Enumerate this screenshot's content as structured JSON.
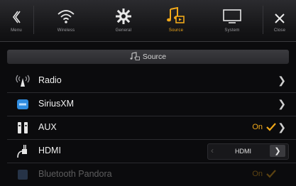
{
  "tabs": [
    {
      "label": "Menu"
    },
    {
      "label": "Wireless"
    },
    {
      "label": "General"
    },
    {
      "label": "Source"
    },
    {
      "label": "System"
    },
    {
      "label": "Close"
    }
  ],
  "active_tab": "Source",
  "section": {
    "title": "Source"
  },
  "rows": [
    {
      "label": "Radio",
      "icon": "antenna-icon"
    },
    {
      "label": "SiriusXM",
      "icon": "siriusxm-icon"
    },
    {
      "label": "AUX",
      "icon": "rca-plug-icon",
      "status": "On"
    },
    {
      "label": "HDMI",
      "icon": "hdmi-cable-icon",
      "value": "HDMI"
    },
    {
      "label": "Bluetooth Pandora",
      "icon": "pandora-icon",
      "status": "On"
    }
  ],
  "colors": {
    "accent": "#f1a91a",
    "background": "#0b0b0d"
  }
}
